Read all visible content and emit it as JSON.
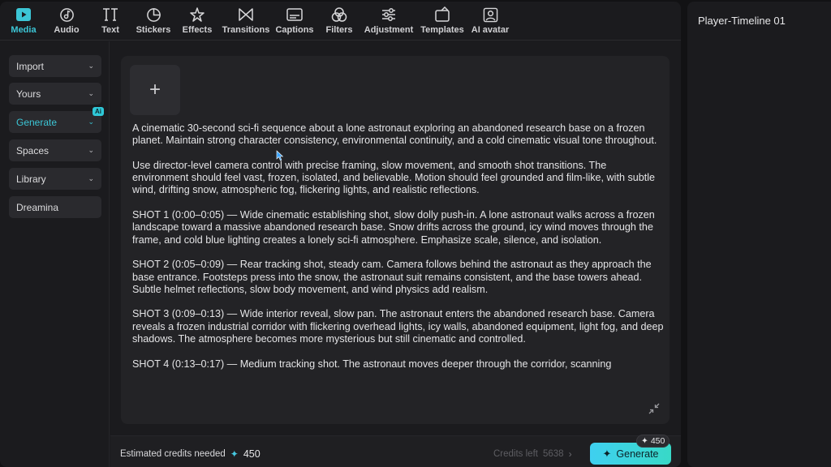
{
  "toolbar": {
    "tabs": [
      {
        "label": "Media",
        "icon": "media-icon",
        "active": true
      },
      {
        "label": "Audio",
        "icon": "audio-icon"
      },
      {
        "label": "Text",
        "icon": "text-icon"
      },
      {
        "label": "Stickers",
        "icon": "stickers-icon"
      },
      {
        "label": "Effects",
        "icon": "effects-icon"
      },
      {
        "label": "Transitions",
        "icon": "transitions-icon"
      },
      {
        "label": "Captions",
        "icon": "captions-icon"
      },
      {
        "label": "Filters",
        "icon": "filters-icon"
      },
      {
        "label": "Adjustment",
        "icon": "adjustment-icon"
      },
      {
        "label": "Templates",
        "icon": "templates-icon"
      },
      {
        "label": "AI avatar",
        "icon": "ai-avatar-icon"
      }
    ]
  },
  "sidebar": {
    "items": [
      {
        "label": "Import",
        "has_chevron": true
      },
      {
        "label": "Yours",
        "has_chevron": true
      },
      {
        "label": "Generate",
        "has_chevron": true,
        "active": true,
        "badge": "Ai"
      },
      {
        "label": "Spaces",
        "has_chevron": true
      },
      {
        "label": "Library",
        "has_chevron": true
      },
      {
        "label": "Dreamina",
        "has_chevron": false
      }
    ]
  },
  "right_panel": {
    "title": "Player-Timeline 01"
  },
  "prompt": {
    "add_label": "+",
    "paragraphs": [
      "A cinematic 30-second sci-fi sequence about a lone astronaut exploring an abandoned research base on a frozen planet. Maintain strong character consistency, environmental continuity, and a cold cinematic visual tone throughout.",
      "Use director-level camera control with precise framing, slow movement, and smooth shot transitions. The environment should feel vast, frozen, isolated, and believable. Motion should feel grounded and film-like, with subtle wind, drifting snow, atmospheric fog, flickering lights, and realistic reflections.",
      "SHOT 1 (0:00–0:05) — Wide cinematic establishing shot, slow dolly push-in. A lone astronaut walks across a frozen landscape toward a massive abandoned research base. Snow drifts across the ground, icy wind moves through the frame, and cold blue lighting creates a lonely sci-fi atmosphere. Emphasize scale, silence, and isolation.",
      "SHOT 2 (0:05–0:09) — Rear tracking shot, steady cam. Camera follows behind the astronaut as they approach the base entrance. Footsteps press into the snow, the astronaut suit remains consistent, and the base towers ahead. Subtle helmet reflections, slow body movement, and wind physics add realism.",
      "SHOT 3 (0:09–0:13) — Wide interior reveal, slow pan. The astronaut enters the abandoned research base. Camera reveals a frozen industrial corridor with flickering overhead lights, icy walls, abandoned equipment, light fog, and deep shadows. The atmosphere becomes more mysterious but still cinematic and controlled.",
      "SHOT 4 (0:13–0:17) — Medium tracking shot. The astronaut moves deeper through the corridor, scanning"
    ]
  },
  "bottom": {
    "estimated_label": "Estimated credits needed",
    "estimated_value": "450",
    "credits_left_label": "Credits left",
    "credits_left_value": "5638",
    "generate_label": "Generate",
    "generate_badge": "450"
  },
  "colors": {
    "accent": "#3cc6d6",
    "generate_gradient_start": "#3fd0f0",
    "generate_gradient_end": "#38d9c7",
    "panel_bg": "#1b1b1e",
    "prompt_bg": "#232326"
  }
}
